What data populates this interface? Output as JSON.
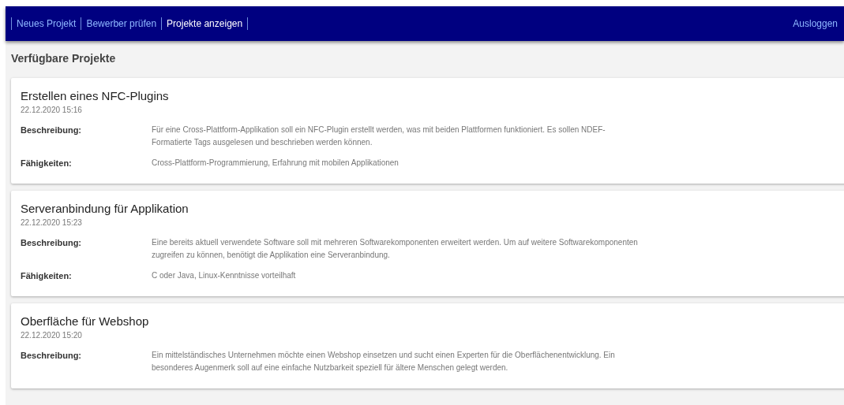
{
  "nav": {
    "links": [
      {
        "label": "Neues Projekt",
        "selected": false
      },
      {
        "label": "Bewerber prüfen",
        "selected": false
      },
      {
        "label": "Projekte anzeigen",
        "selected": true
      }
    ],
    "logout": "Ausloggen"
  },
  "heading": "Verfügbare Projekte",
  "projects": [
    {
      "title": "Erstellen eines NFC-Plugins",
      "date": "22.12.2020 15:16",
      "fields": [
        {
          "label": "Beschreibung:",
          "value": "Für eine Cross-Plattform-Applikation soll ein NFC-Plugin erstellt werden, was mit beiden Plattformen funktioniert. Es sollen NDEF-Formatierte Tags ausgelesen und beschrieben werden können."
        },
        {
          "label": "Fähigkeiten:",
          "value": "Cross-Plattform-Programmierung, Erfahrung mit mobilen Applikationen"
        }
      ]
    },
    {
      "title": "Serveranbindung für Applikation",
      "date": "22.12.2020 15:23",
      "fields": [
        {
          "label": "Beschreibung:",
          "value": "Eine bereits aktuell verwendete Software soll mit mehreren Softwarekomponenten erweitert werden. Um auf weitere Softwarekomponenten zugreifen zu können, benötigt die Applikation eine Serveranbindung."
        },
        {
          "label": "Fähigkeiten:",
          "value": "C oder Java, Linux-Kenntnisse vorteilhaft"
        }
      ]
    },
    {
      "title": "Oberfläche für Webshop",
      "date": "22.12.2020 15:20",
      "fields": [
        {
          "label": "Beschreibung:",
          "value": "Ein mittelständisches Unternehmen möchte einen Webshop einsetzen und sucht einen Experten für die Oberflächenentwicklung. Ein besonderes Augenmerk soll auf eine einfache Nutzbarkeit speziell für ältere Menschen gelegt werden."
        }
      ]
    }
  ]
}
